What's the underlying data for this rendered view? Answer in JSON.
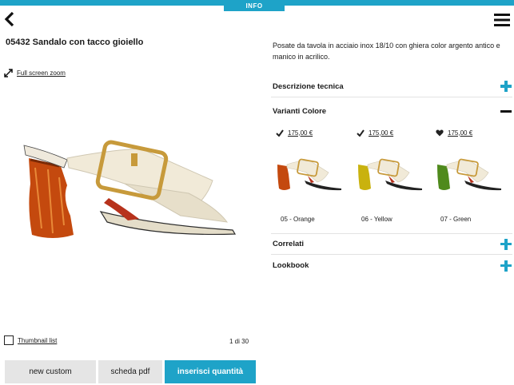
{
  "header": {
    "info_tab": "INFO"
  },
  "product": {
    "title": "05432 Sandalo con tacco gioiello",
    "zoom_label": "Full screen zoom",
    "description": "Posate da tavola in acciaio inox 18/10 con ghiera color argento antico e manico in acrilico."
  },
  "gallery": {
    "thumbnail_label": "Thumbnail list",
    "page_count": "1 di 30"
  },
  "actions": {
    "new_custom": "new custom",
    "pdf": "scheda pdf",
    "add_quantity": "inserisci quantità"
  },
  "sections": {
    "technical": "Descrizione tecnica",
    "colors": "Varianti Colore",
    "related": "Correlati",
    "lookbook": "Lookbook"
  },
  "variants": [
    {
      "price": "175,00 €",
      "name": "05 - Orange",
      "status_icon": "check-icon",
      "heel_color": "#c4490e"
    },
    {
      "price": "175,00 €",
      "name": "06 - Yellow",
      "status_icon": "check-icon",
      "heel_color": "#c9b20e"
    },
    {
      "price": "175,00 €",
      "name": "07 - Green",
      "status_icon": "heart-icon",
      "heel_color": "#4f8a1c"
    }
  ],
  "colors": {
    "accent": "#1ea3c8",
    "button_gray": "#e5e5e5",
    "strap": "#f1ead8"
  }
}
